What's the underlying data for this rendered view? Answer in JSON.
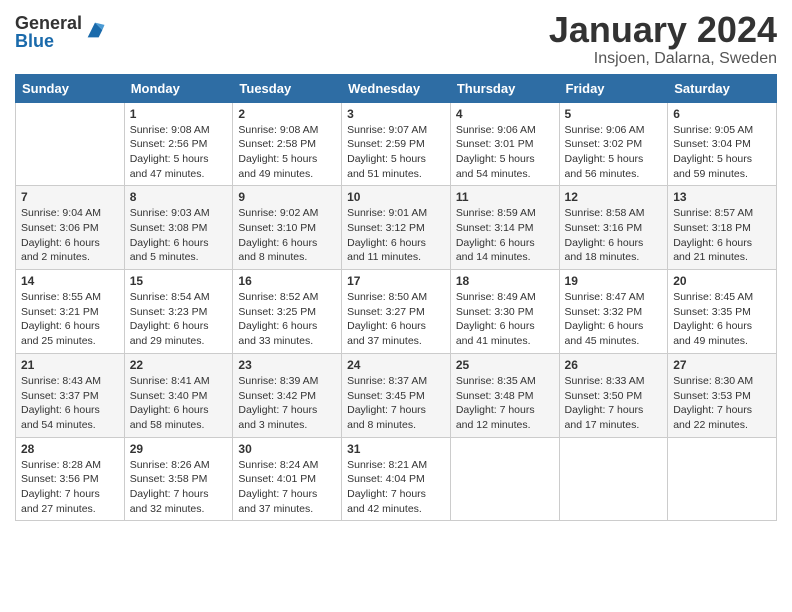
{
  "logo": {
    "general": "General",
    "blue": "Blue"
  },
  "title": "January 2024",
  "location": "Insjoen, Dalarna, Sweden",
  "days_of_week": [
    "Sunday",
    "Monday",
    "Tuesday",
    "Wednesday",
    "Thursday",
    "Friday",
    "Saturday"
  ],
  "weeks": [
    [
      {
        "num": "",
        "details": ""
      },
      {
        "num": "1",
        "details": "Sunrise: 9:08 AM\nSunset: 2:56 PM\nDaylight: 5 hours\nand 47 minutes."
      },
      {
        "num": "2",
        "details": "Sunrise: 9:08 AM\nSunset: 2:58 PM\nDaylight: 5 hours\nand 49 minutes."
      },
      {
        "num": "3",
        "details": "Sunrise: 9:07 AM\nSunset: 2:59 PM\nDaylight: 5 hours\nand 51 minutes."
      },
      {
        "num": "4",
        "details": "Sunrise: 9:06 AM\nSunset: 3:01 PM\nDaylight: 5 hours\nand 54 minutes."
      },
      {
        "num": "5",
        "details": "Sunrise: 9:06 AM\nSunset: 3:02 PM\nDaylight: 5 hours\nand 56 minutes."
      },
      {
        "num": "6",
        "details": "Sunrise: 9:05 AM\nSunset: 3:04 PM\nDaylight: 5 hours\nand 59 minutes."
      }
    ],
    [
      {
        "num": "7",
        "details": "Sunrise: 9:04 AM\nSunset: 3:06 PM\nDaylight: 6 hours\nand 2 minutes."
      },
      {
        "num": "8",
        "details": "Sunrise: 9:03 AM\nSunset: 3:08 PM\nDaylight: 6 hours\nand 5 minutes."
      },
      {
        "num": "9",
        "details": "Sunrise: 9:02 AM\nSunset: 3:10 PM\nDaylight: 6 hours\nand 8 minutes."
      },
      {
        "num": "10",
        "details": "Sunrise: 9:01 AM\nSunset: 3:12 PM\nDaylight: 6 hours\nand 11 minutes."
      },
      {
        "num": "11",
        "details": "Sunrise: 8:59 AM\nSunset: 3:14 PM\nDaylight: 6 hours\nand 14 minutes."
      },
      {
        "num": "12",
        "details": "Sunrise: 8:58 AM\nSunset: 3:16 PM\nDaylight: 6 hours\nand 18 minutes."
      },
      {
        "num": "13",
        "details": "Sunrise: 8:57 AM\nSunset: 3:18 PM\nDaylight: 6 hours\nand 21 minutes."
      }
    ],
    [
      {
        "num": "14",
        "details": "Sunrise: 8:55 AM\nSunset: 3:21 PM\nDaylight: 6 hours\nand 25 minutes."
      },
      {
        "num": "15",
        "details": "Sunrise: 8:54 AM\nSunset: 3:23 PM\nDaylight: 6 hours\nand 29 minutes."
      },
      {
        "num": "16",
        "details": "Sunrise: 8:52 AM\nSunset: 3:25 PM\nDaylight: 6 hours\nand 33 minutes."
      },
      {
        "num": "17",
        "details": "Sunrise: 8:50 AM\nSunset: 3:27 PM\nDaylight: 6 hours\nand 37 minutes."
      },
      {
        "num": "18",
        "details": "Sunrise: 8:49 AM\nSunset: 3:30 PM\nDaylight: 6 hours\nand 41 minutes."
      },
      {
        "num": "19",
        "details": "Sunrise: 8:47 AM\nSunset: 3:32 PM\nDaylight: 6 hours\nand 45 minutes."
      },
      {
        "num": "20",
        "details": "Sunrise: 8:45 AM\nSunset: 3:35 PM\nDaylight: 6 hours\nand 49 minutes."
      }
    ],
    [
      {
        "num": "21",
        "details": "Sunrise: 8:43 AM\nSunset: 3:37 PM\nDaylight: 6 hours\nand 54 minutes."
      },
      {
        "num": "22",
        "details": "Sunrise: 8:41 AM\nSunset: 3:40 PM\nDaylight: 6 hours\nand 58 minutes."
      },
      {
        "num": "23",
        "details": "Sunrise: 8:39 AM\nSunset: 3:42 PM\nDaylight: 7 hours\nand 3 minutes."
      },
      {
        "num": "24",
        "details": "Sunrise: 8:37 AM\nSunset: 3:45 PM\nDaylight: 7 hours\nand 8 minutes."
      },
      {
        "num": "25",
        "details": "Sunrise: 8:35 AM\nSunset: 3:48 PM\nDaylight: 7 hours\nand 12 minutes."
      },
      {
        "num": "26",
        "details": "Sunrise: 8:33 AM\nSunset: 3:50 PM\nDaylight: 7 hours\nand 17 minutes."
      },
      {
        "num": "27",
        "details": "Sunrise: 8:30 AM\nSunset: 3:53 PM\nDaylight: 7 hours\nand 22 minutes."
      }
    ],
    [
      {
        "num": "28",
        "details": "Sunrise: 8:28 AM\nSunset: 3:56 PM\nDaylight: 7 hours\nand 27 minutes."
      },
      {
        "num": "29",
        "details": "Sunrise: 8:26 AM\nSunset: 3:58 PM\nDaylight: 7 hours\nand 32 minutes."
      },
      {
        "num": "30",
        "details": "Sunrise: 8:24 AM\nSunset: 4:01 PM\nDaylight: 7 hours\nand 37 minutes."
      },
      {
        "num": "31",
        "details": "Sunrise: 8:21 AM\nSunset: 4:04 PM\nDaylight: 7 hours\nand 42 minutes."
      },
      {
        "num": "",
        "details": ""
      },
      {
        "num": "",
        "details": ""
      },
      {
        "num": "",
        "details": ""
      }
    ]
  ]
}
